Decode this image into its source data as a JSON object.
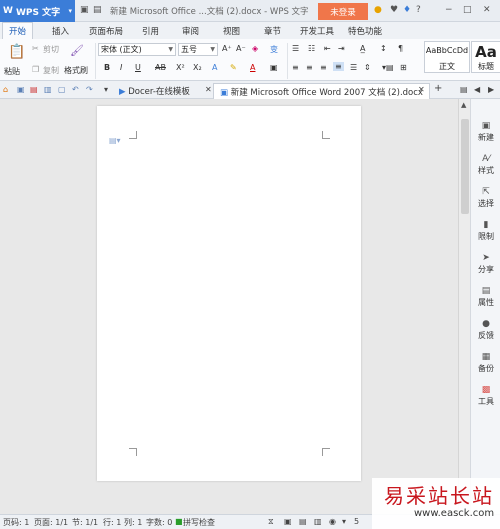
{
  "titlebar": {
    "app_label": "WPS 文字",
    "doc_title": "新建 Microsoft Office ...文档 (2).docx - WPS 文字",
    "login_label": "未登录"
  },
  "ribbon_tabs": [
    "开始",
    "插入",
    "页面布局",
    "引用",
    "审阅",
    "视图",
    "章节",
    "开发工具",
    "特色功能"
  ],
  "ribbon": {
    "paste": "粘贴",
    "cut": "剪切",
    "copy": "复制",
    "format_painter": "格式刷",
    "font_name": "宋体 (正文)",
    "font_size": "五号",
    "styles": [
      {
        "preview": "AaBbCcDd",
        "name": "正文"
      },
      {
        "preview": "Aa",
        "name": "标题"
      }
    ]
  },
  "doc_tabs": {
    "docer": "Docer-在线模板",
    "active_doc": "新建 Microsoft Office Word 2007 文档 (2).docx"
  },
  "sidebar": [
    "新建",
    "样式",
    "选择",
    "限制",
    "分享",
    "属性",
    "反馈",
    "备份",
    "工具"
  ],
  "status": {
    "page_num": "页码: 1",
    "pages": "页面: 1/1",
    "section": "节: 1/1",
    "row": "行: 1",
    "col": "列: 1",
    "words": "字数: 0",
    "spell": "拼写检查",
    "zoom": "5"
  },
  "watermark": {
    "cn": "易采站长站",
    "url": "www.easck.com"
  },
  "colors": {
    "wps_blue": "#3b7dd8",
    "login_orange": "#f0764a",
    "watermark_red": "#c8161d"
  }
}
